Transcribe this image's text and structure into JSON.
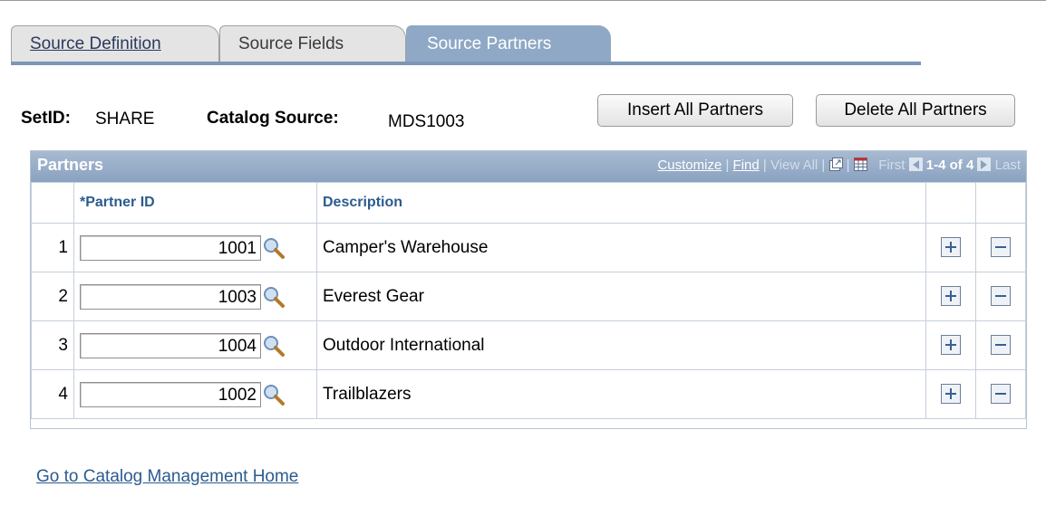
{
  "tabs": [
    {
      "label": "Source Definition"
    },
    {
      "label": "Source Fields"
    },
    {
      "label": "Source Partners"
    }
  ],
  "header": {
    "setid_label": "SetID:",
    "setid_value": "SHARE",
    "catalog_label": "Catalog Source:",
    "catalog_value": "MDS1003",
    "insert_button": "Insert All Partners",
    "delete_button": "Delete All Partners"
  },
  "grid": {
    "title": "Partners",
    "customize": "Customize",
    "find": "Find",
    "view_all": "View All",
    "first": "First",
    "range": "1-4 of 4",
    "last": "Last",
    "columns": {
      "partner_id": "*Partner ID",
      "description": "Description"
    },
    "rows": [
      {
        "num": "1",
        "partner_id": "1001",
        "description": "Camper's Warehouse"
      },
      {
        "num": "2",
        "partner_id": "1003",
        "description": "Everest Gear"
      },
      {
        "num": "3",
        "partner_id": "1004",
        "description": "Outdoor International"
      },
      {
        "num": "4",
        "partner_id": "1002",
        "description": "Trailblazers"
      }
    ]
  },
  "footer": {
    "home_link": "Go to Catalog Management Home"
  },
  "colors": {
    "accent": "#8fa8c5",
    "header_text": "#2c5b8f"
  }
}
